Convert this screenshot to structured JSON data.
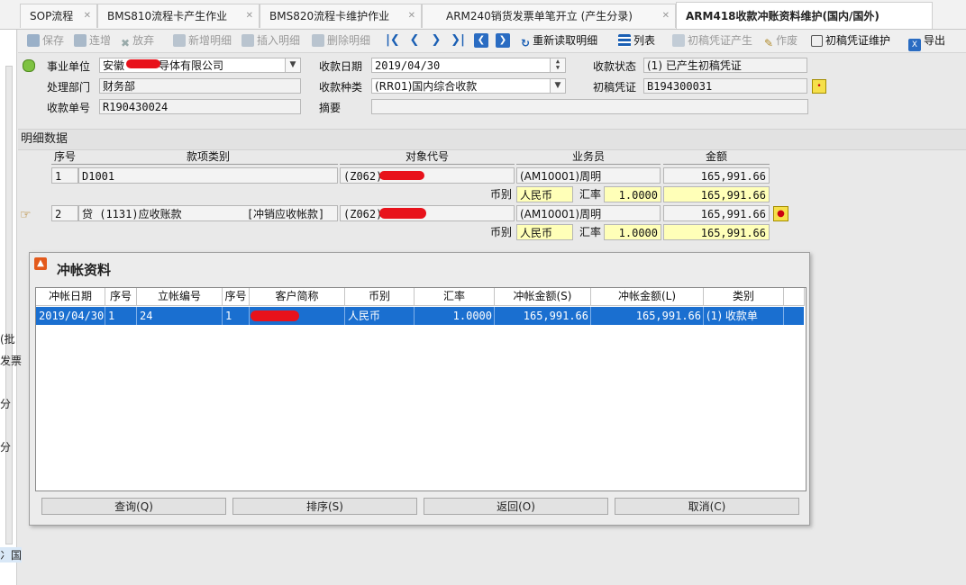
{
  "tabs": [
    {
      "label": "SOP流程"
    },
    {
      "label": "BMS810流程卡产生作业"
    },
    {
      "label": "BMS820流程卡维护作业"
    },
    {
      "label": "ARM240销货发票单笔开立 (产生分录)"
    },
    {
      "label": "ARM418收款冲账资料维护(国内/国外)"
    }
  ],
  "left_fragments": [
    "(批",
    "发票",
    "分",
    "分",
    "冫国"
  ],
  "toolbar": {
    "save": "保存",
    "continue_add": "连增",
    "discard": "放弃",
    "add_detail": "新增明细",
    "insert_detail": "插入明细",
    "delete_detail": "删除明细",
    "reload_detail": "重新读取明细",
    "list": "列表",
    "draft_voucher_gen": "初稿凭证产生",
    "void": "作废",
    "draft_voucher_maint": "初稿凭证维护",
    "export": "导出"
  },
  "form": {
    "business_unit_label": "事业单位",
    "business_unit_value_a": "安徽",
    "business_unit_value_b": "导体有限公司",
    "dept_label": "处理部门",
    "dept_value": "财务部",
    "receipt_no_label": "收款单号",
    "receipt_no_value": "R190430024",
    "receipt_date_label": "收款日期",
    "receipt_date_value": "2019/04/30",
    "receipt_type_label": "收款种类",
    "receipt_type_value": "(RR01)国内综合收款",
    "summary_label": "摘要",
    "summary_value": "",
    "status_label": "收款状态",
    "status_value": "(1) 已产生初稿凭证",
    "draft_voucher_label": "初稿凭证",
    "draft_voucher_value": "B194300031"
  },
  "detail": {
    "title": "明细数据",
    "headers": {
      "seq": "序号",
      "item_type": "款项类别",
      "object_code": "对象代号",
      "salesperson": "业务员",
      "amount": "金额"
    },
    "rows": [
      {
        "seq": "1",
        "item": "D1001",
        "object": "(Z062)",
        "salesperson": "(AM10001)周明",
        "amount": "165,991.66",
        "currency_label": "币别",
        "currency": "人民币",
        "rate_label": "汇率",
        "rate": "1.0000",
        "amount2": "165,991.66"
      },
      {
        "seq": "2",
        "item": "贷 (1131)应收账款          [冲销应收帐款]",
        "object": "(Z062)",
        "salesperson": "(AM10001)周明",
        "amount": "165,991.66",
        "currency_label": "币别",
        "currency": "人民币",
        "rate_label": "汇率",
        "rate": "1.0000",
        "amount2": "165,991.66"
      }
    ]
  },
  "dialog": {
    "title": "冲帐资料",
    "columns": [
      "冲帐日期",
      "序号",
      "立帐编号",
      "序号",
      "客户简称",
      "币别",
      "汇率",
      "冲帐金额(S)",
      "冲帐金额(L)",
      "类别"
    ],
    "rows": [
      [
        "2019/04/30",
        "1",
        "24",
        "1",
        "",
        "人民币",
        "1.0000",
        "165,991.66",
        "165,991.66",
        "(1) 收款单"
      ]
    ],
    "buttons": {
      "query": "查询(Q)",
      "sort": "排序(S)",
      "back": "返回(O)",
      "cancel": "取消(C)"
    }
  },
  "colors": {
    "accent": "#1a6fd0",
    "yellow_field": "#ffffb8",
    "redact": "#e8121b"
  }
}
